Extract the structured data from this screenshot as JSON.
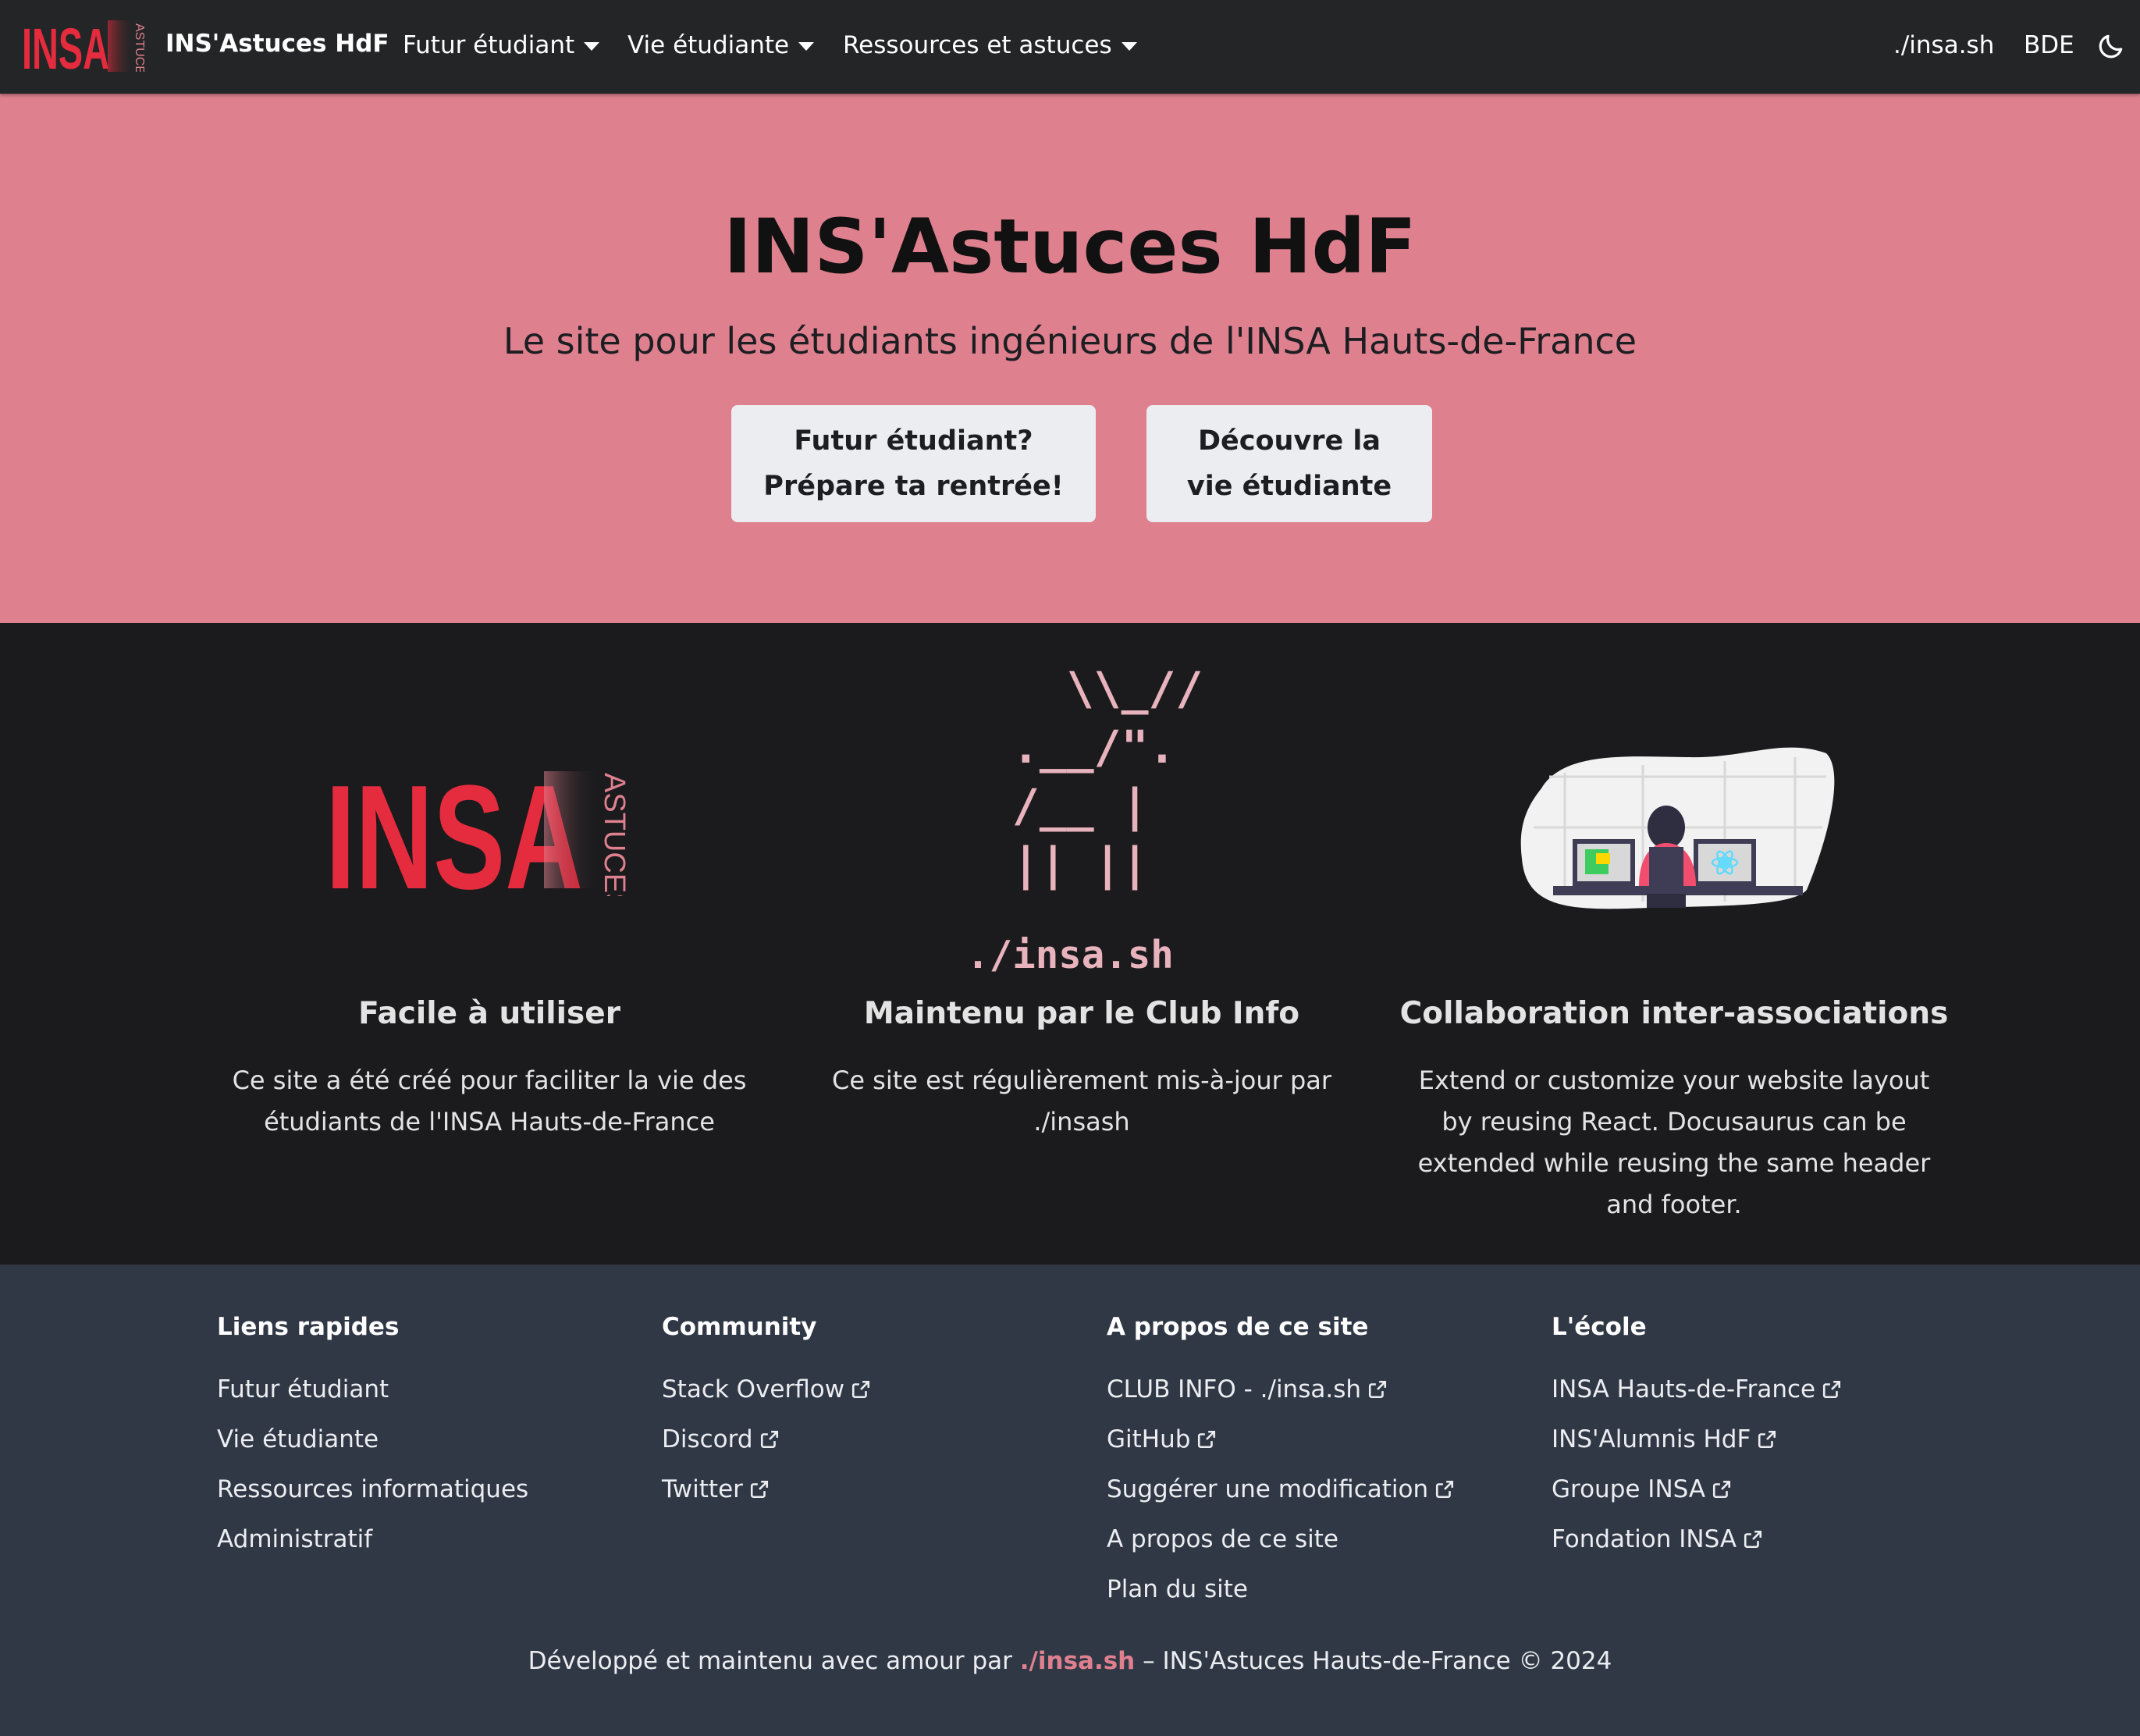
{
  "colors": {
    "navbar_bg": "#242526",
    "hero_bg": "#df808f",
    "features_bg": "#1b1b1d",
    "footer_bg": "#303846",
    "accent": "#df808f",
    "insa_red": "#e52b3e"
  },
  "navbar": {
    "logo_text": "INSA",
    "logo_sub": "ASTUCES",
    "title": "INS'Astuces HdF",
    "items": [
      {
        "label": "Futur étudiant",
        "icon": "caret-down-icon"
      },
      {
        "label": "Vie étudiante",
        "icon": "caret-down-icon"
      },
      {
        "label": "Ressources et astuces",
        "icon": "caret-down-icon"
      }
    ],
    "right_links": [
      "./insa.sh",
      "BDE"
    ],
    "theme_toggle_icon": "moon-icon"
  },
  "hero": {
    "title": "INS'Astuces HdF",
    "subtitle": "Le site pour les étudiants ingénieurs de l'INSA Hauts-de-France",
    "buttons": [
      {
        "label": "Futur étudiant?\nPrépare ta rentrée!"
      },
      {
        "label": "Découvre la\nvie étudiante"
      }
    ]
  },
  "features": [
    {
      "image": "insa-astuces-logo",
      "logo_text": "INSA",
      "logo_sub": "ASTUCES",
      "title": "Facile à utiliser",
      "description": "Ce site a été créé pour faciliter la vie des étudiants de l'INSA Hauts-de-France"
    },
    {
      "image": "ascii-moose-art",
      "ascii_art": "   \\\\_//\n .__/\".\n /__ |\n || ||",
      "ascii_label": "./insa.sh",
      "title": "Maintenu par le Club Info",
      "description": "Ce site est régulièrement mis-à-jour par ./insash"
    },
    {
      "image": "developer-at-desk-illustration",
      "title": "Collaboration inter-associations",
      "description": "Extend or customize your website layout by reusing React. Docusaurus can be extended while reusing the same header and footer."
    }
  ],
  "footer": {
    "columns": [
      {
        "title": "Liens rapides",
        "links": [
          {
            "label": "Futur étudiant",
            "external": false
          },
          {
            "label": "Vie étudiante",
            "external": false
          },
          {
            "label": "Ressources informatiques",
            "external": false
          },
          {
            "label": "Administratif",
            "external": false
          }
        ]
      },
      {
        "title": "Community",
        "links": [
          {
            "label": "Stack Overflow",
            "external": true
          },
          {
            "label": "Discord",
            "external": true
          },
          {
            "label": "Twitter",
            "external": true
          }
        ]
      },
      {
        "title": "A propos de ce site",
        "links": [
          {
            "label": "CLUB INFO - ./insa.sh",
            "external": true
          },
          {
            "label": "GitHub",
            "external": true
          },
          {
            "label": "Suggérer une modification",
            "external": true
          },
          {
            "label": "A propos de ce site",
            "external": false
          },
          {
            "label": "Plan du site",
            "external": false
          }
        ]
      },
      {
        "title": "L'école",
        "links": [
          {
            "label": "INSA Hauts-de-France",
            "external": true
          },
          {
            "label": "INS'Alumnis HdF",
            "external": true
          },
          {
            "label": "Groupe INSA",
            "external": true
          },
          {
            "label": "Fondation INSA",
            "external": true
          }
        ]
      }
    ],
    "copyright": {
      "prefix": "Développé et maintenu avec amour par ",
      "brand": "./insa.sh",
      "suffix": " – INS'Astuces Hauts-de-France © 2024"
    }
  }
}
